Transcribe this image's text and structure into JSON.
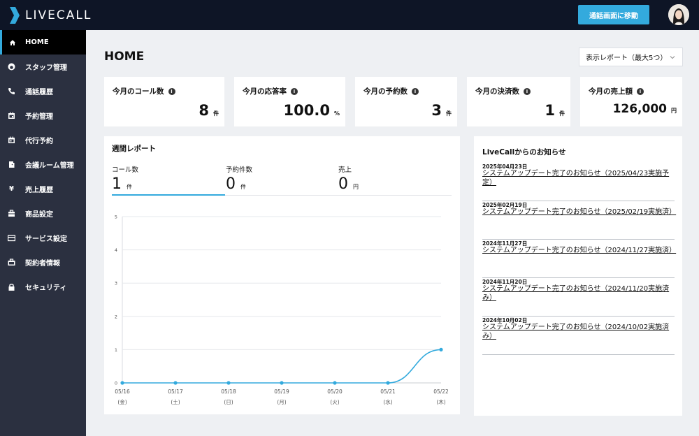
{
  "app": {
    "logo_text": "LIVECALL",
    "accent": "#33aadd",
    "header_bg": "#0e1526",
    "sidebar_bg": "#2b3040"
  },
  "header": {
    "call_screen_button": "通話画面に移動",
    "avatar": "user-avatar"
  },
  "sidebar": {
    "items": [
      {
        "label": "HOME",
        "icon": "home-icon",
        "active": true
      },
      {
        "label": "スタッフ管理",
        "icon": "staff-icon"
      },
      {
        "label": "通話履歴",
        "icon": "phone-icon"
      },
      {
        "label": "予約管理",
        "icon": "calendar-icon"
      },
      {
        "label": "代行予約",
        "icon": "calendar-check-icon"
      },
      {
        "label": "会議ルーム管理",
        "icon": "door-icon"
      },
      {
        "label": "売上履歴",
        "icon": "yen-icon"
      },
      {
        "label": "商品設定",
        "icon": "box-icon"
      },
      {
        "label": "サービス設定",
        "icon": "card-icon"
      },
      {
        "label": "契約者情報",
        "icon": "briefcase-icon"
      },
      {
        "label": "セキュリティ",
        "icon": "lock-icon"
      }
    ]
  },
  "main": {
    "title": "HOME",
    "report_select": "表示レポート（最大5つ）",
    "stats": [
      {
        "label": "今月のコール数",
        "value": "8",
        "unit": "件"
      },
      {
        "label": "今月の応答率",
        "value": "100.0",
        "unit": "%"
      },
      {
        "label": "今月の予約数",
        "value": "3",
        "unit": "件"
      },
      {
        "label": "今月の決済数",
        "value": "1",
        "unit": "件"
      },
      {
        "label": "今月の売上額",
        "value": "126,000",
        "unit": "円"
      }
    ]
  },
  "weekly": {
    "title": "週間レポート",
    "metrics": [
      {
        "label": "コール数",
        "value": "1",
        "unit": "件"
      },
      {
        "label": "予約件数",
        "value": "0",
        "unit": "件"
      },
      {
        "label": "売上",
        "value": "0",
        "unit": "円"
      }
    ]
  },
  "chart_data": {
    "type": "line",
    "categories": [
      "05/16",
      "05/17",
      "05/18",
      "05/19",
      "05/20",
      "05/21",
      "05/22"
    ],
    "sublabels": [
      "(金)",
      "(土)",
      "(日)",
      "(月)",
      "(火)",
      "(水)",
      "(木)"
    ],
    "values": [
      0,
      0,
      0,
      0,
      0,
      0,
      1
    ],
    "ylim": [
      0,
      5
    ],
    "yticks": [
      0,
      1,
      2,
      3,
      4,
      5
    ],
    "grid": true,
    "color": "#33aadd"
  },
  "news": {
    "title": "LiveCallからのお知らせ",
    "items": [
      {
        "date": "2025年04月23日",
        "text": "システムアップデート完了のお知らせ（2025/04/23実施予定）"
      },
      {
        "date": "2025年02月19日",
        "text": "システムアップデート完了のお知らせ（2025/02/19実施済）"
      },
      {
        "date": "2024年11月27日",
        "text": "システムアップデート完了のお知らせ（2024/11/27実施済）"
      },
      {
        "date": "2024年11月20日",
        "text": "システムアップデート完了のお知らせ（2024/11/20実施済み）"
      },
      {
        "date": "2024年10月02日",
        "text": "システムアップデート完了のお知らせ（2024/10/02実施済み）"
      }
    ]
  }
}
